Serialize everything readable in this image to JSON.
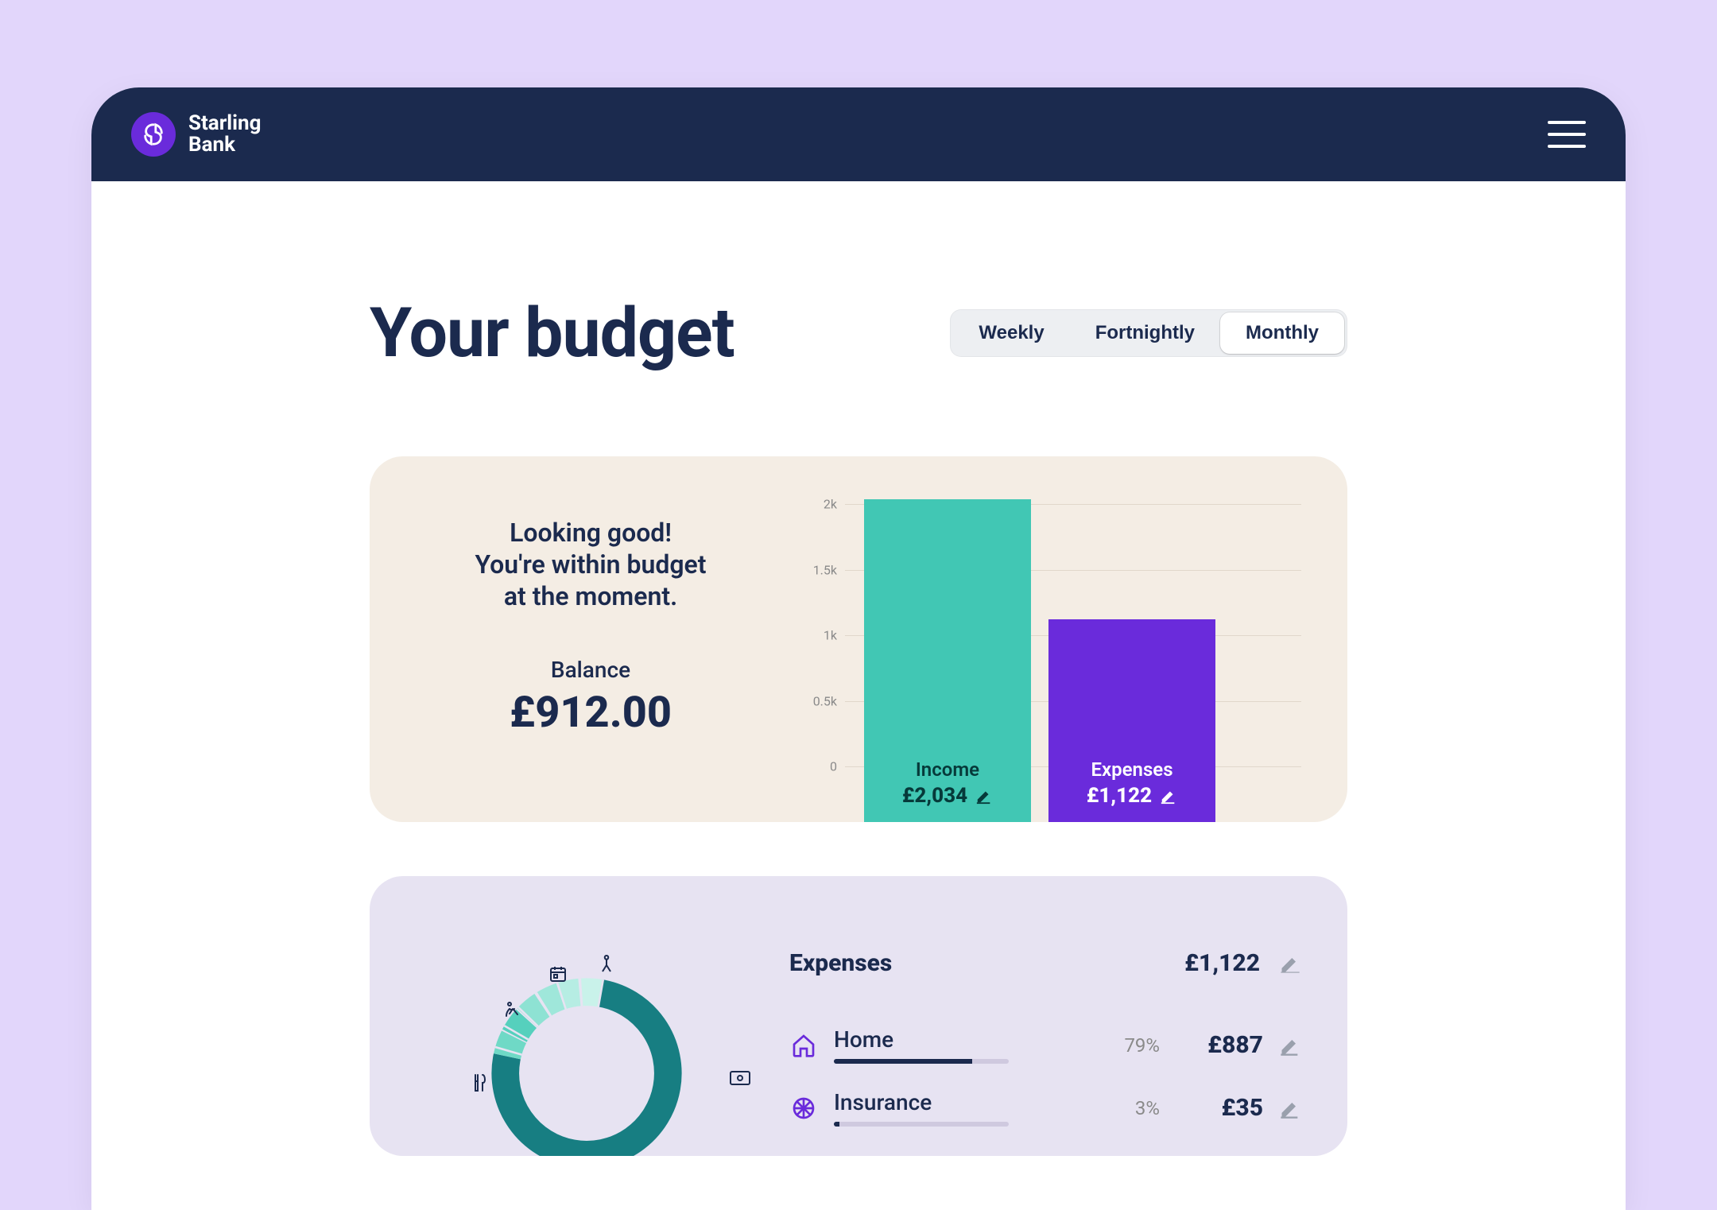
{
  "brand": {
    "line1": "Starling",
    "line2": "Bank"
  },
  "title": "Your budget",
  "segments": {
    "weekly": "Weekly",
    "fortnightly": "Fortnightly",
    "monthly": "Monthly",
    "active": "monthly"
  },
  "summary": {
    "message_l1": "Looking good!",
    "message_l2": "You're within budget",
    "message_l3": "at the moment.",
    "balance_label": "Balance",
    "balance_value": "£912.00"
  },
  "bars": {
    "income": {
      "label": "Income",
      "value_text": "£2,034",
      "value_num": 2034,
      "color": "#41c7b4"
    },
    "expenses": {
      "label": "Expenses",
      "value_text": "£1,122",
      "value_num": 1122,
      "color": "#6a2bdb"
    }
  },
  "yticks": [
    "0",
    "0.5k",
    "1k",
    "1.5k",
    "2k"
  ],
  "expenses": {
    "heading": "Expenses",
    "total": "£1,122",
    "items": [
      {
        "icon": "home",
        "name": "Home",
        "pct": "79%",
        "pct_num": 79,
        "amount": "£887"
      },
      {
        "icon": "insurance",
        "name": "Insurance",
        "pct": "3%",
        "pct_num": 3,
        "amount": "£35"
      }
    ]
  },
  "chart_data": {
    "type": "bar",
    "title": "Your budget",
    "categories": [
      "Income",
      "Expenses"
    ],
    "values": [
      2034,
      1122
    ],
    "xlabel": "",
    "ylabel": "",
    "ylim": [
      0,
      2000
    ],
    "yticks": [
      0,
      500,
      1000,
      1500,
      2000
    ],
    "series": [
      {
        "name": "Income",
        "values": [
          2034
        ],
        "color": "#41c7b4"
      },
      {
        "name": "Expenses",
        "values": [
          1122
        ],
        "color": "#6a2bdb"
      }
    ],
    "balance": 912.0,
    "period": "Monthly"
  }
}
